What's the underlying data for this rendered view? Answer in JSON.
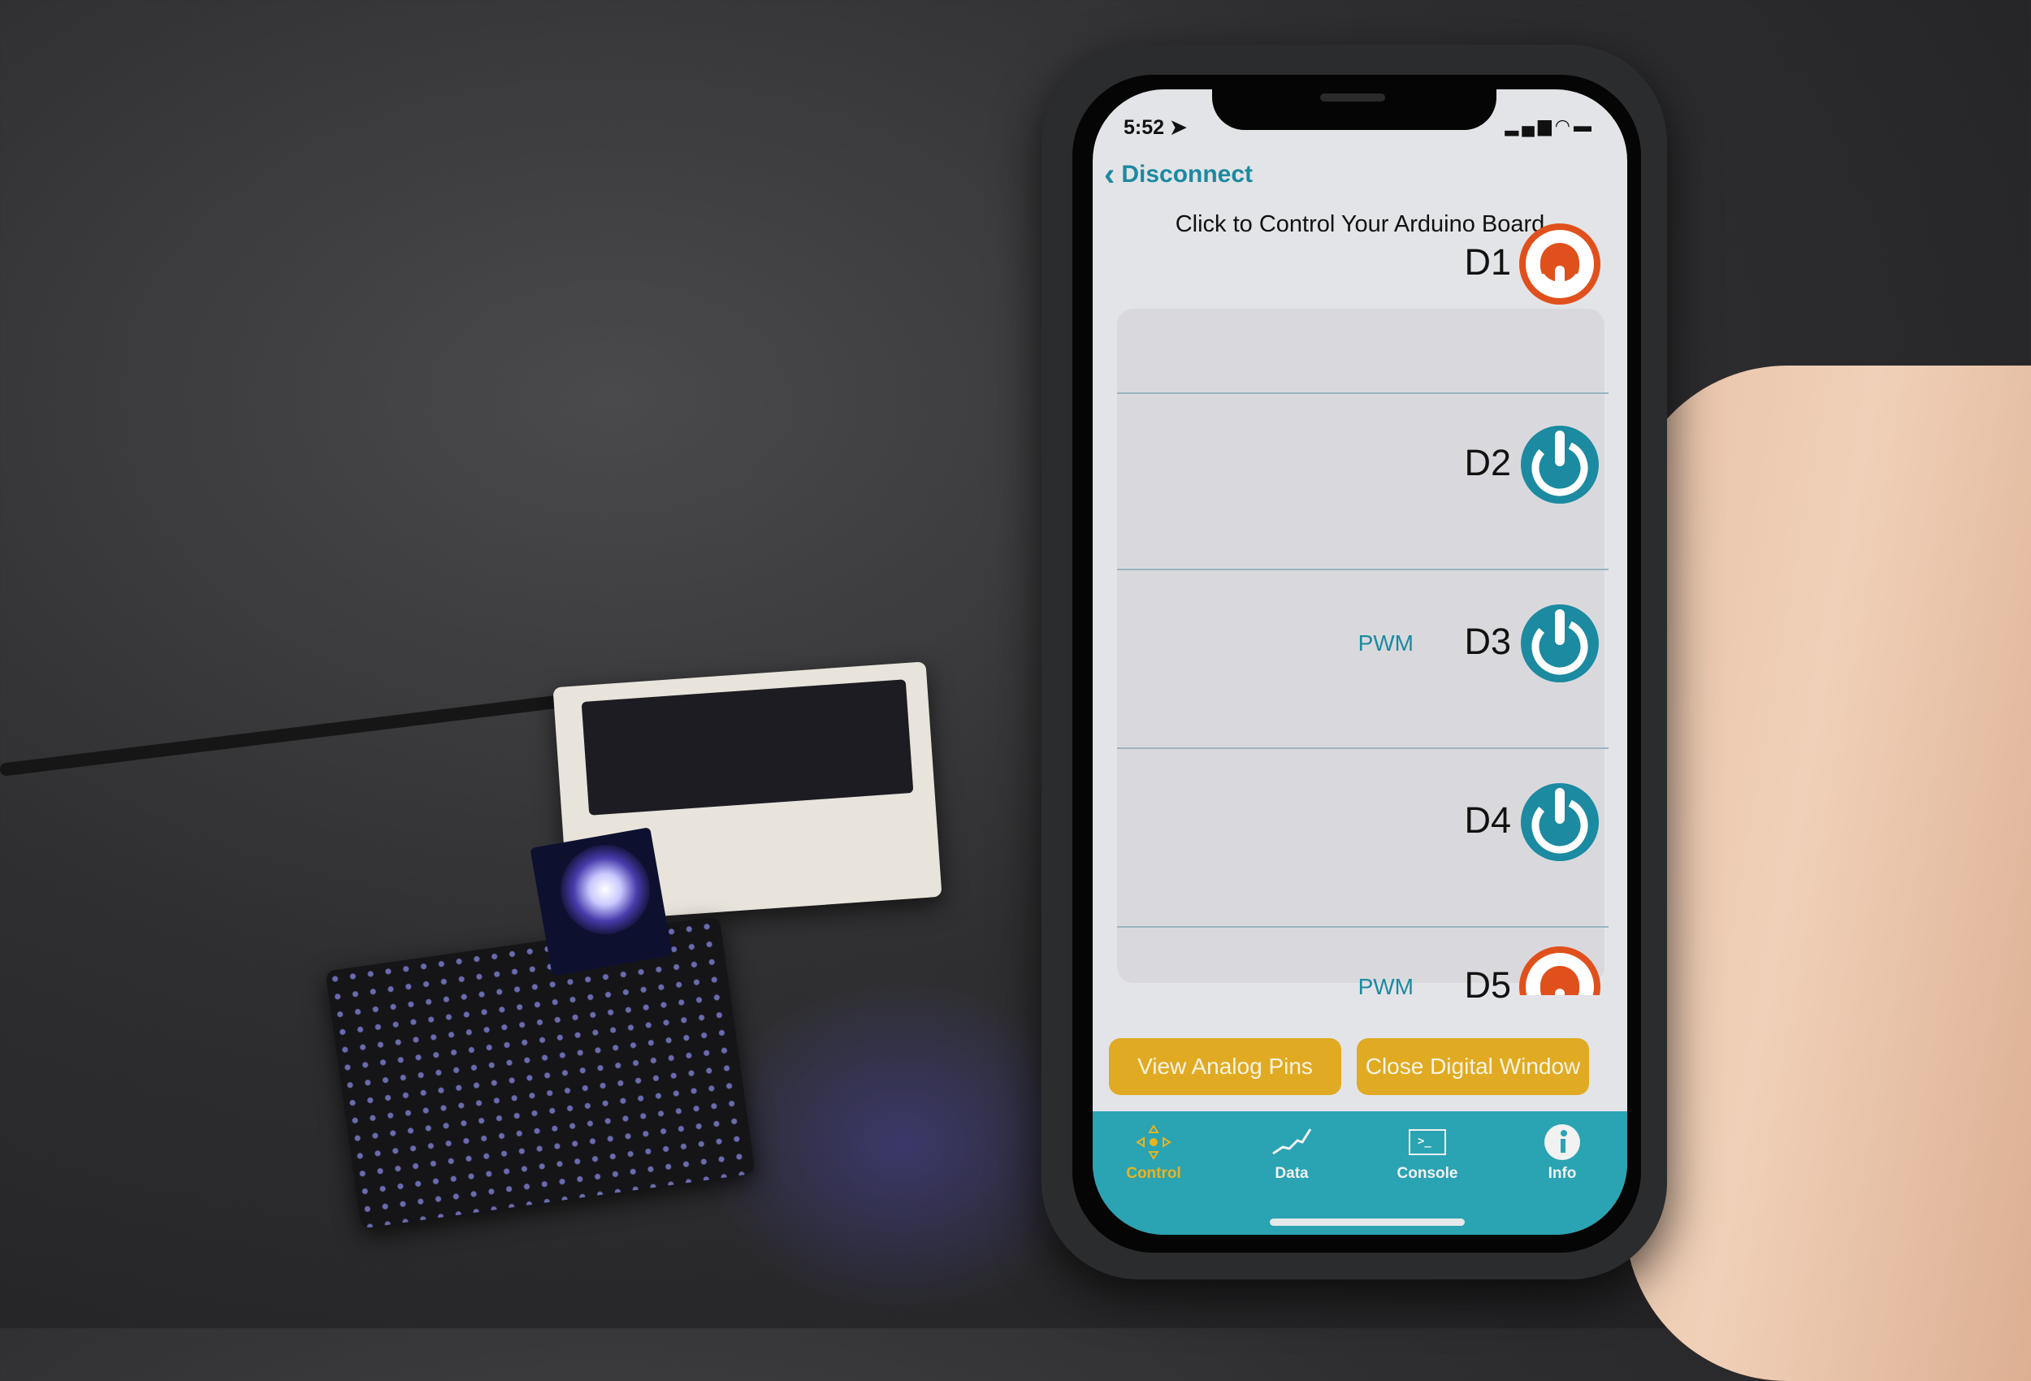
{
  "status_bar": {
    "time": "5:52",
    "location_icon": "location-arrow-icon",
    "signal_icons": [
      "cellular-signal-icon",
      "wifi-icon",
      "battery-icon"
    ]
  },
  "nav": {
    "back_label": "Disconnect",
    "back_icon": "chevron-left-icon"
  },
  "header": {
    "title": "Click to Control Your Arduino Board"
  },
  "pins": [
    {
      "label": "D1",
      "pwm": "",
      "state": "on",
      "color": "#e0501c"
    },
    {
      "label": "D2",
      "pwm": "",
      "state": "off",
      "color": "#1c8aa0"
    },
    {
      "label": "D3",
      "pwm": "PWM",
      "state": "off",
      "color": "#1c8aa0"
    },
    {
      "label": "D4",
      "pwm": "",
      "state": "off",
      "color": "#1c8aa0"
    },
    {
      "label": "D5",
      "pwm": "PWM",
      "state": "on",
      "color": "#e0501c"
    }
  ],
  "buttons": {
    "analog": "View Analog Pins",
    "close": "Close Digital Window"
  },
  "tabs": [
    {
      "label": "Control",
      "icon": "dpad-icon",
      "active": true
    },
    {
      "label": "Data",
      "icon": "line-graph-icon",
      "active": false
    },
    {
      "label": "Console",
      "icon": "terminal-icon",
      "active": false
    },
    {
      "label": "Info",
      "icon": "info-icon",
      "active": false
    }
  ],
  "colors": {
    "accent": "#1c8aa0",
    "on": "#e0501c",
    "button": "#e0aa22",
    "tabbar": "#2aa3b3",
    "active_tab": "#e8b422"
  }
}
